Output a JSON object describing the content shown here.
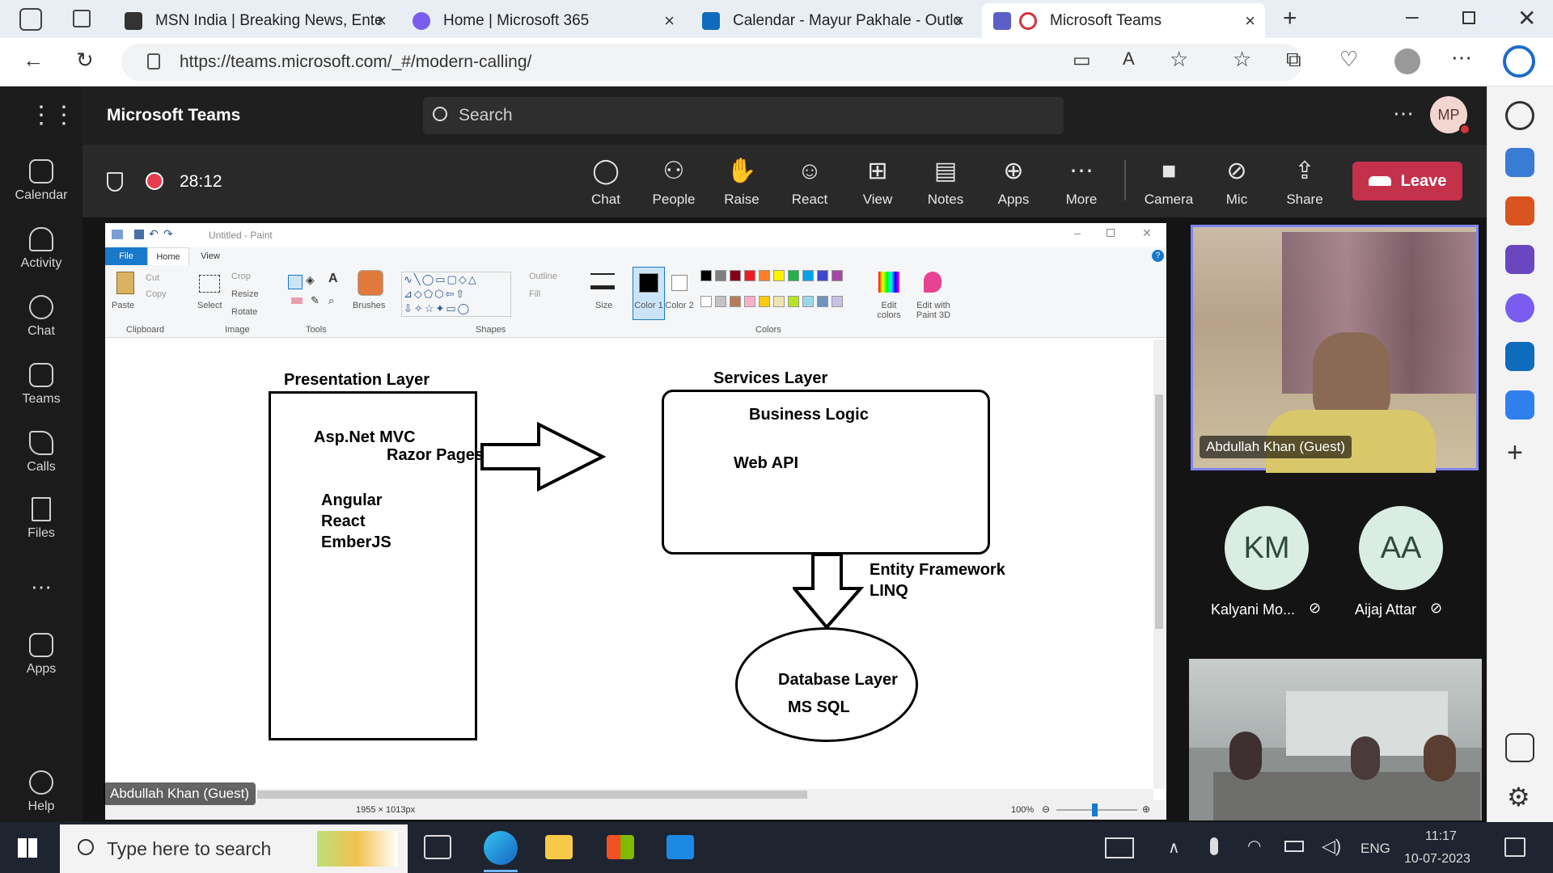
{
  "browser": {
    "tabs": [
      {
        "title": "MSN India | Breaking News, Ente",
        "active": false
      },
      {
        "title": "Home | Microsoft 365",
        "active": false
      },
      {
        "title": "Calendar - Mayur Pakhale - Outlo",
        "active": false
      },
      {
        "title": "Microsoft Teams",
        "active": true
      }
    ],
    "url": "https://teams.microsoft.com/_#/modern-calling/"
  },
  "teams": {
    "app_title": "Microsoft Teams",
    "search_placeholder": "Search",
    "user_initials": "MP",
    "rail": [
      "Calendar",
      "Activity",
      "Chat",
      "Teams",
      "Calls",
      "Files",
      "Apps",
      "Help"
    ],
    "call": {
      "timer": "28:12",
      "buttons": [
        "Chat",
        "People",
        "Raise",
        "React",
        "View",
        "Notes",
        "Apps",
        "More",
        "Camera",
        "Mic",
        "Share"
      ],
      "leave_label": "Leave"
    },
    "shared_screen_presenter": "Abdullah Khan (Guest)",
    "participants": [
      {
        "name": "Abdullah Khan (Guest)",
        "initials": ""
      },
      {
        "name": "Kalyani Mo...",
        "initials": "KM"
      },
      {
        "name": "Aijaj Attar",
        "initials": "AA"
      }
    ]
  },
  "paint": {
    "title": "Untitled - Paint",
    "tabs": [
      "File",
      "Home",
      "View"
    ],
    "groups": [
      "Clipboard",
      "Image",
      "Tools",
      "Shapes",
      "Colors"
    ],
    "tools": {
      "paste": "Paste",
      "cut": "Cut",
      "copy": "Copy",
      "select": "Select",
      "crop": "Crop",
      "resize": "Resize",
      "rotate": "Rotate",
      "brushes": "Brushes",
      "outline": "Outline",
      "fill": "Fill",
      "size": "Size",
      "color1": "Color 1",
      "color2": "Color 2",
      "edit_colors": "Edit colors",
      "paint3d": "Edit with Paint 3D"
    },
    "palette": [
      "#000000",
      "#7f7f7f",
      "#880015",
      "#ed1c24",
      "#ff7f27",
      "#fff200",
      "#22b14c",
      "#00a2e8",
      "#3f48cc",
      "#a349a4",
      "#ffffff",
      "#c3c3c3",
      "#b97a57",
      "#ffaec9",
      "#ffc90e",
      "#efe4b0",
      "#b5e61d",
      "#99d9ea",
      "#7092be",
      "#c8bfe7"
    ],
    "status_size": "1955 × 1013px",
    "zoom": "100%"
  },
  "diagram": {
    "presentation_title": "Presentation Layer",
    "presentation_items": [
      "Asp.Net MVC",
      "Razor Pages",
      "Angular",
      "React",
      "EmberJS"
    ],
    "services_title": "Services Layer",
    "services_items": [
      "Business Logic",
      "Web API"
    ],
    "link_label": [
      "Entity Framework",
      "LINQ"
    ],
    "database_items": [
      "Database Layer",
      "MS SQL"
    ]
  },
  "taskbar": {
    "search_placeholder": "Type here to search",
    "lang": "ENG",
    "time": "11:17",
    "date": "10-07-2023"
  }
}
